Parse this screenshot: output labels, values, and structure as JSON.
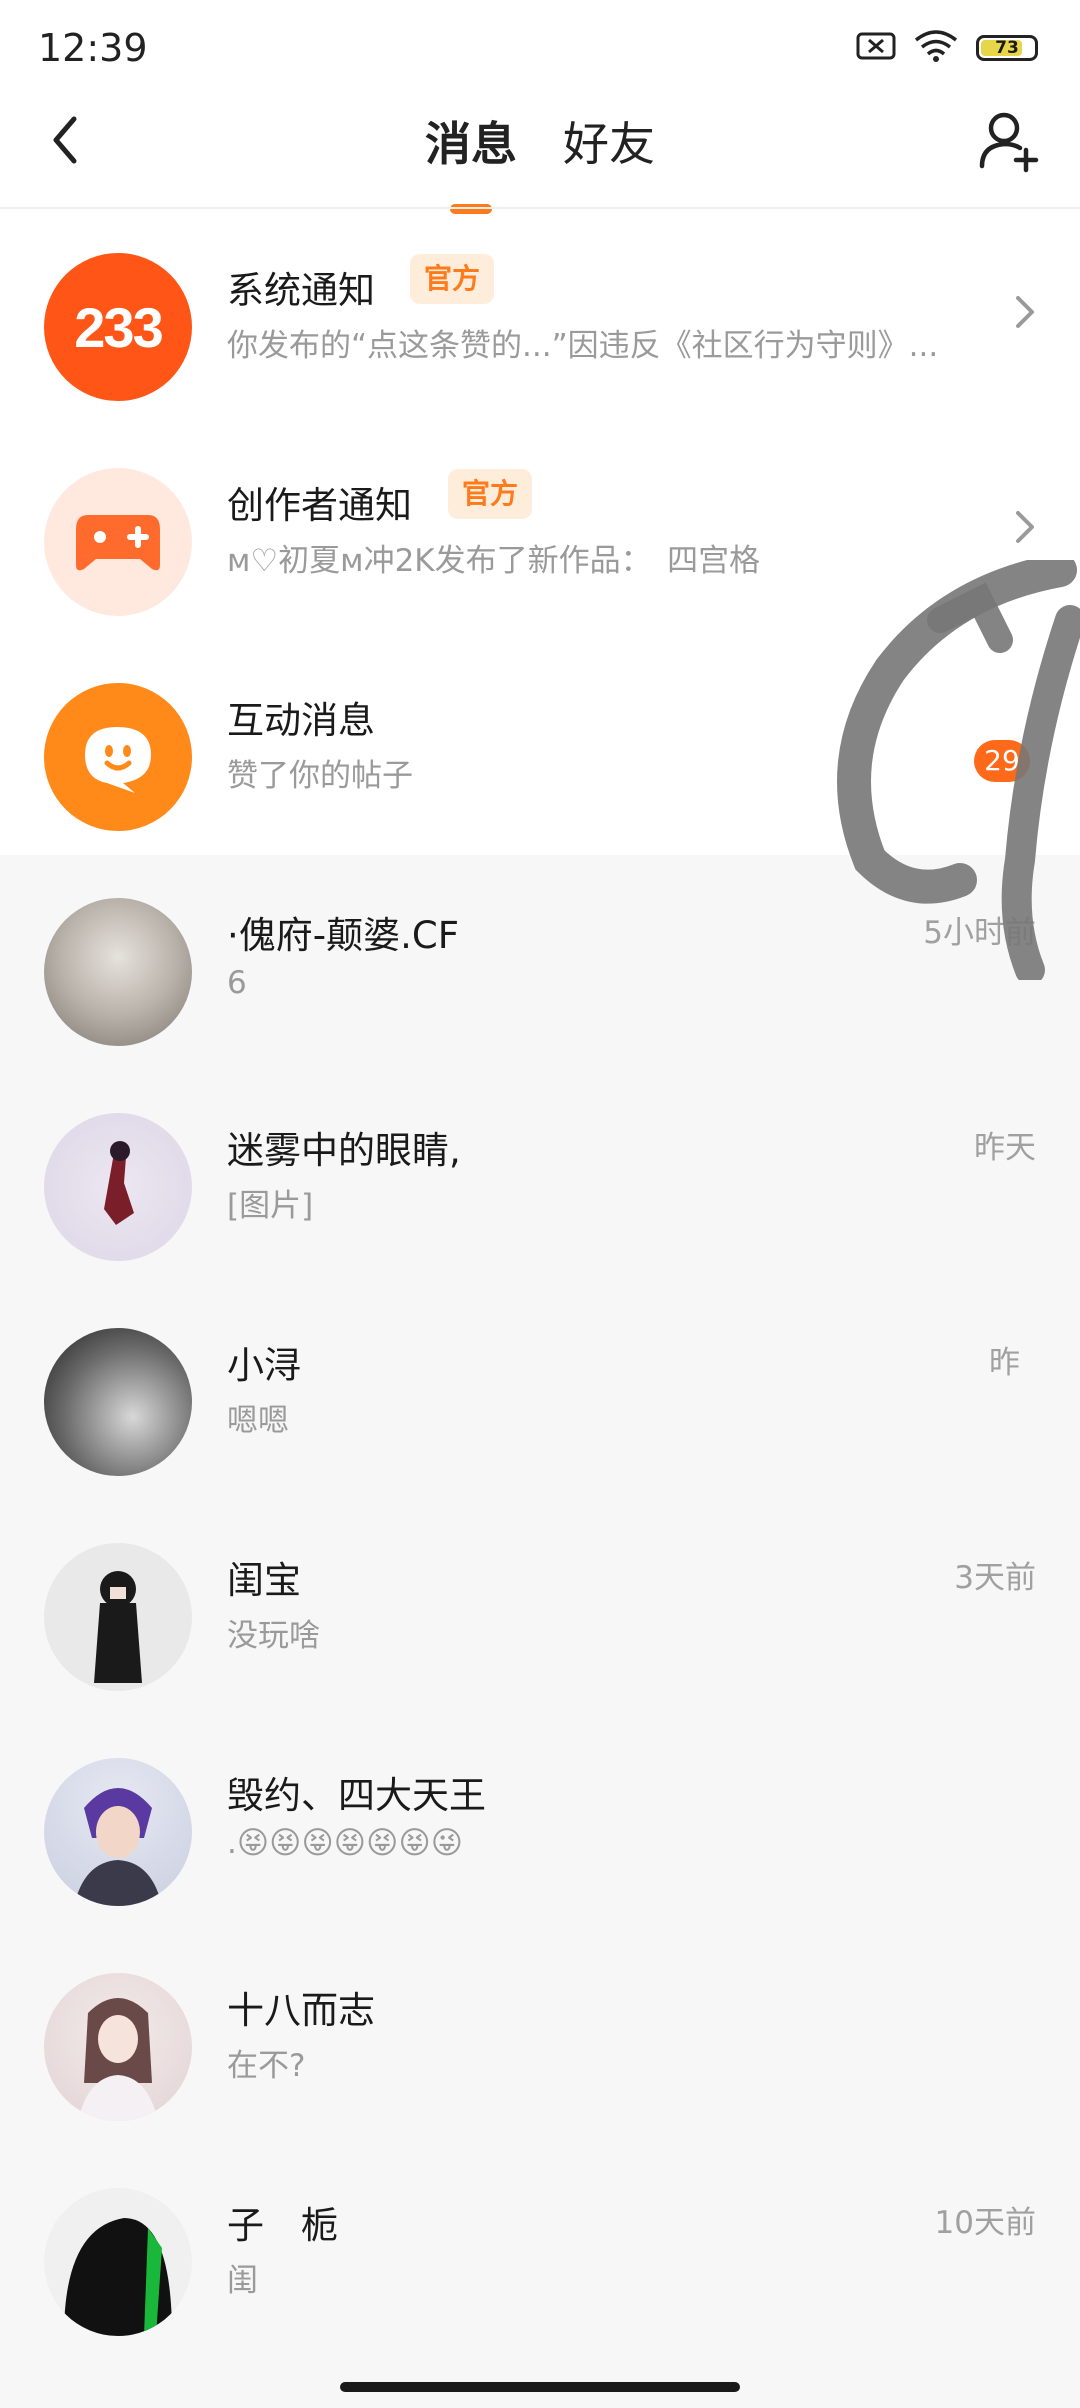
{
  "status_bar": {
    "time": "12:39",
    "battery": "73"
  },
  "header": {
    "tabs": [
      {
        "label": "消息",
        "active": true
      },
      {
        "label": "好友",
        "active": false
      }
    ]
  },
  "official_notices": [
    {
      "name": "系统通知",
      "badge": "官方",
      "preview": "你发布的“点这条赞的...”因违反《社区行为守则》...",
      "avatar_icon": "233-logo-icon",
      "avatar_color": "#ff5517",
      "avatar_text": "233"
    },
    {
      "name": "创作者通知",
      "badge": "官方",
      "preview": "ᴍ♡初夏ᴍ冲2K发布了新作品：　四宫格",
      "avatar_icon": "gamepad-icon",
      "avatar_color": "#ffe9df"
    },
    {
      "name": "互动消息",
      "preview": "赞了你的帖子",
      "count": "29",
      "avatar_icon": "chat-bubble-icon",
      "avatar_color": "#ff8a1a"
    }
  ],
  "conversations": [
    {
      "name": "·傀府-颠婆.CF",
      "preview": "6",
      "time": "5小时前"
    },
    {
      "name": "迷雾中的眼睛,",
      "preview": "[图片]",
      "time": "昨天"
    },
    {
      "name": "小浔",
      "preview": "嗯嗯",
      "time": "昨"
    },
    {
      "name": "闺宝",
      "preview": "没玩啥",
      "time": "3天前"
    },
    {
      "name": "毁约、四大天王",
      "preview": ".😝😝😝😝😝😝😜",
      "time": ""
    },
    {
      "name": "十八而志",
      "preview": "在不?",
      "time": ""
    },
    {
      "name": "子　栀",
      "preview": "闺",
      "time": "10天前"
    }
  ],
  "colors": {
    "accent": "#ff7a1a",
    "badge_bg": "#ffeddc"
  }
}
